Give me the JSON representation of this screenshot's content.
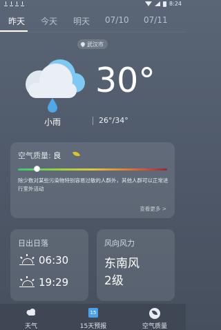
{
  "status_bar": {
    "time": "8:24"
  },
  "tabs": [
    {
      "label": "昨天",
      "active": true
    },
    {
      "label": "今天",
      "active": false
    },
    {
      "label": "明天",
      "active": false
    },
    {
      "label": "07/10",
      "active": false
    },
    {
      "label": "07/11",
      "active": false
    }
  ],
  "location": "武汉市",
  "weather": {
    "icon": "cloud-rain-icon",
    "condition": "小雨",
    "temperature": "30°",
    "range": "26°/34°"
  },
  "air_quality": {
    "title": "空气质量:",
    "level": "良",
    "level_fraction": 0.12,
    "description": "除少数对某些污染物特别容易过敏的人群外，其他人群可以正常进行室外活动",
    "more_label": "查看更多 >",
    "bar_colors": [
      "#37c87a",
      "#e2c63a",
      "#e0863a",
      "#8e2a36"
    ]
  },
  "sun_card": {
    "title": "日出日落",
    "sunrise": "06:30",
    "sunset": "19:29"
  },
  "wind_card": {
    "title": "风向风力",
    "direction": "东南风",
    "level": "2级"
  },
  "bottom_nav": [
    {
      "label": "天气",
      "icon": "cloud-icon",
      "active": false
    },
    {
      "label": "15天预报",
      "icon": "calendar-icon",
      "icon_text": "15",
      "active": true
    },
    {
      "label": "空气质量",
      "icon": "leaf-icon",
      "active": false
    }
  ],
  "colors": {
    "accent_blue": "#4aa3e8",
    "aqi_good": "#e5c02a"
  }
}
